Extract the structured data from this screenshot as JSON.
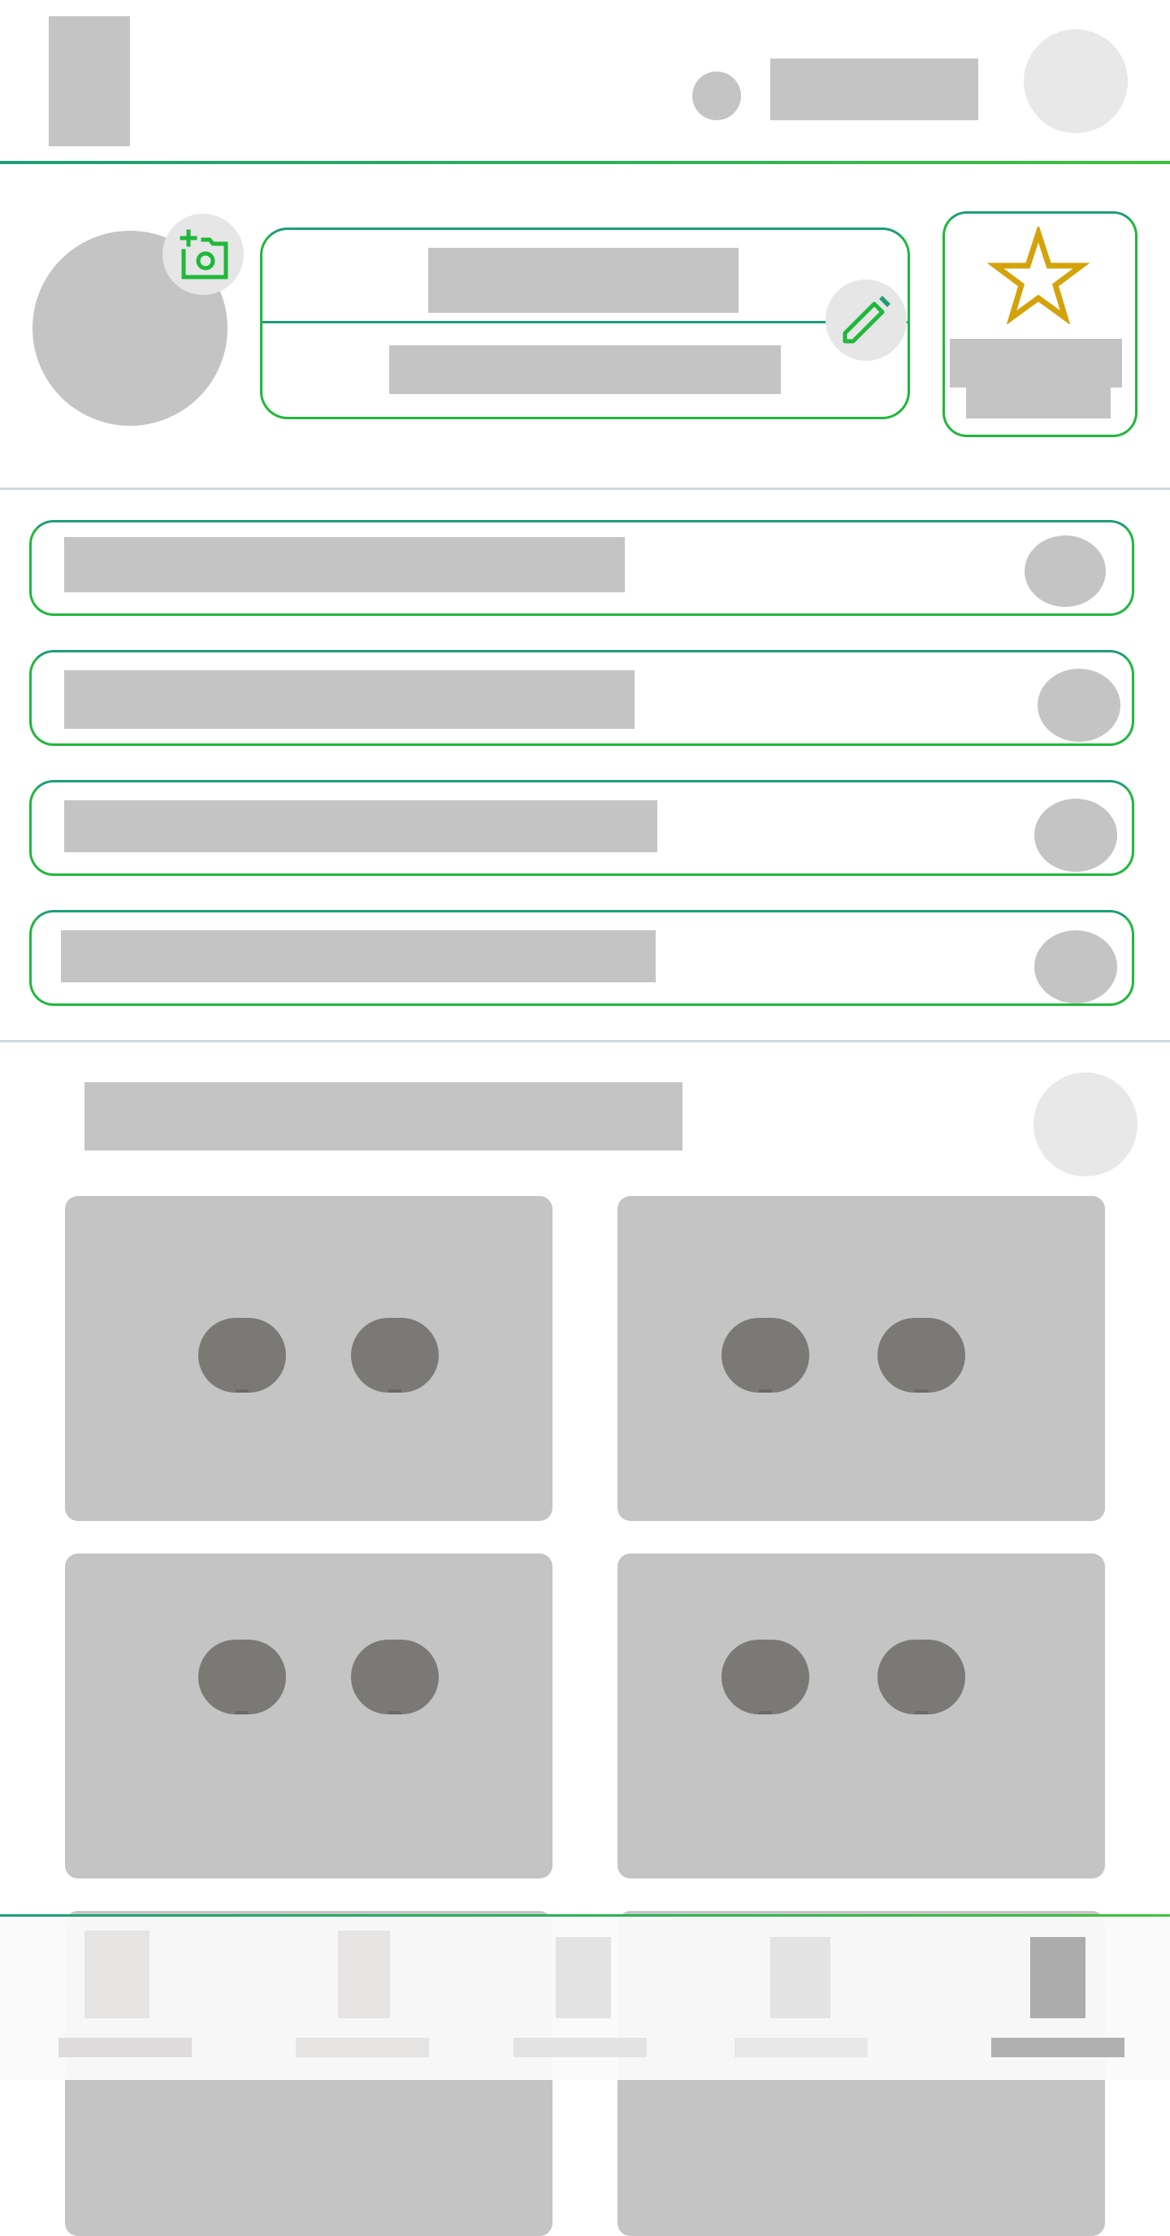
{
  "header": {
    "logo": "logo-placeholder",
    "status_icon": "status-dot-icon",
    "title_text": "",
    "avatar_icon": "avatar-icon"
  },
  "profile": {
    "add_photo_icon": "add-photo-camera-icon",
    "name_text": "",
    "subtitle_text": "",
    "edit_icon": "pencil-icon",
    "favorite_icon": "star-icon",
    "favorite_label": ""
  },
  "settings_rows": [
    {
      "label": "",
      "icon": "row-toggle-icon"
    },
    {
      "label": "",
      "icon": "row-toggle-icon"
    },
    {
      "label": "",
      "icon": "row-toggle-icon"
    },
    {
      "label": "",
      "icon": "row-toggle-icon"
    }
  ],
  "devices": {
    "title": "",
    "add_icon": "add-circle-icon",
    "tiles": [
      {
        "icon": "device-icon"
      },
      {
        "icon": "device-icon"
      },
      {
        "icon": "device-icon"
      },
      {
        "icon": "device-icon"
      }
    ]
  },
  "bottom_nav": {
    "items": [
      {
        "label": "",
        "active": false
      },
      {
        "label": "",
        "active": false
      },
      {
        "label": "",
        "active": false
      },
      {
        "label": "",
        "active": false
      },
      {
        "label": "",
        "active": true
      }
    ]
  },
  "colors": {
    "accent_green": "#1fb83a",
    "accent_teal": "#1e9e78",
    "star_gold": "#d4a20a",
    "placeholder": "#c4c4c4",
    "divider": "#d0d8df"
  }
}
